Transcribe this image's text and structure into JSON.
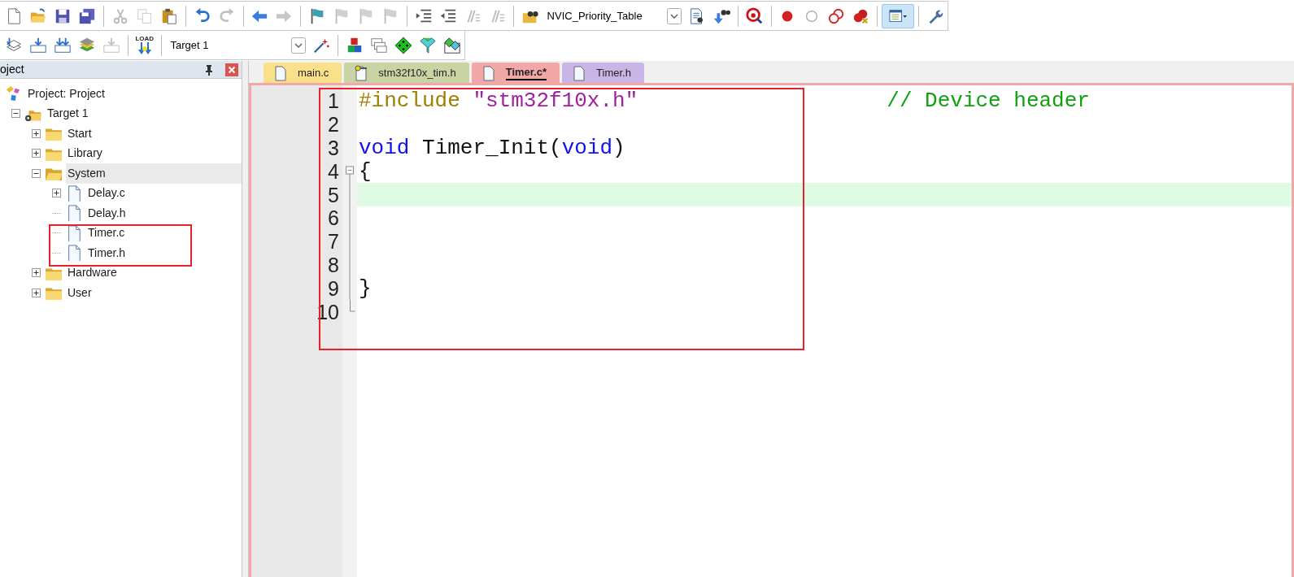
{
  "toolbar_1": [
    {
      "kind": "new",
      "disabled": false,
      "pressed": false
    },
    {
      "kind": "open",
      "disabled": false,
      "pressed": false
    },
    {
      "kind": "save",
      "disabled": false,
      "pressed": false
    },
    {
      "kind": "save_all",
      "disabled": false,
      "pressed": false
    },
    {
      "kind": "separator"
    },
    {
      "kind": "cut",
      "disabled": true,
      "pressed": false
    },
    {
      "kind": "copy",
      "disabled": true,
      "pressed": false
    },
    {
      "kind": "paste",
      "disabled": false,
      "pressed": false
    },
    {
      "kind": "separator"
    },
    {
      "kind": "undo",
      "disabled": false,
      "pressed": false
    },
    {
      "kind": "redo",
      "disabled": true,
      "pressed": false
    },
    {
      "kind": "separator"
    },
    {
      "kind": "back",
      "disabled": false,
      "pressed": false
    },
    {
      "kind": "forward",
      "disabled": true,
      "pressed": false
    },
    {
      "kind": "separator"
    },
    {
      "kind": "bookmark",
      "disabled": false,
      "pressed": false
    },
    {
      "kind": "bookmark",
      "disabled": true,
      "pressed": false
    },
    {
      "kind": "bookmark",
      "disabled": true,
      "pressed": false
    },
    {
      "kind": "bookmark",
      "disabled": true,
      "pressed": false
    },
    {
      "kind": "separator"
    },
    {
      "kind": "indent",
      "disabled": false,
      "pressed": false
    },
    {
      "kind": "unindent",
      "disabled": false,
      "pressed": false
    },
    {
      "kind": "comment",
      "disabled": true,
      "pressed": false
    },
    {
      "kind": "comment",
      "disabled": true,
      "pressed": false
    },
    {
      "kind": "separator"
    },
    {
      "kind": "find_files",
      "disabled": false,
      "pressed": false
    },
    {
      "kind": "combo",
      "value": "NVIC_Priority_Table"
    },
    {
      "kind": "find",
      "disabled": false,
      "pressed": false
    },
    {
      "kind": "incremental_find",
      "disabled": false,
      "pressed": false
    },
    {
      "kind": "separator"
    },
    {
      "kind": "debug",
      "disabled": false,
      "pressed": false
    },
    {
      "kind": "separator"
    },
    {
      "kind": "breakpoint",
      "disabled": false,
      "pressed": false
    },
    {
      "kind": "breakpoint_off",
      "disabled": false,
      "pressed": false
    },
    {
      "kind": "breakpoint_enable",
      "disabled": false,
      "pressed": false
    },
    {
      "kind": "breakpoint_kill",
      "disabled": false,
      "pressed": false
    },
    {
      "kind": "separator"
    },
    {
      "kind": "window",
      "disabled": false,
      "pressed": true
    },
    {
      "kind": "separator"
    },
    {
      "kind": "wrench",
      "disabled": false,
      "pressed": false
    }
  ],
  "toolbar_2": [
    {
      "kind": "translate",
      "disabled": false,
      "pressed": false
    },
    {
      "kind": "build",
      "disabled": false,
      "pressed": false
    },
    {
      "kind": "rebuild",
      "disabled": false,
      "pressed": false
    },
    {
      "kind": "batch",
      "disabled": false,
      "pressed": false
    },
    {
      "kind": "build",
      "disabled": true,
      "pressed": false
    },
    {
      "kind": "separator"
    },
    {
      "kind": "load",
      "label": "LOAD",
      "disabled": false,
      "pressed": false
    },
    {
      "kind": "separator"
    },
    {
      "kind": "combo",
      "value": "Target 1"
    },
    {
      "kind": "wand",
      "disabled": false,
      "pressed": false
    },
    {
      "kind": "separator"
    },
    {
      "kind": "blocks",
      "disabled": false,
      "pressed": false
    },
    {
      "kind": "windows",
      "disabled": false,
      "pressed": false
    },
    {
      "kind": "diamond",
      "disabled": false,
      "pressed": false
    },
    {
      "kind": "funnel",
      "disabled": false,
      "pressed": false
    },
    {
      "kind": "packs",
      "disabled": false,
      "pressed": false
    }
  ],
  "project_panel": {
    "title": "oject",
    "tree": [
      {
        "kind": "project",
        "label": "Project: Project",
        "selected": false,
        "children": [
          {
            "kind": "target",
            "label": "Target 1",
            "expanded": true,
            "selected": false,
            "children": [
              {
                "kind": "group",
                "label": "Start",
                "expanded": false,
                "selected": false
              },
              {
                "kind": "group",
                "label": "Library",
                "expanded": false,
                "selected": false
              },
              {
                "kind": "group",
                "label": "System",
                "expanded": true,
                "selected": true,
                "children": [
                  {
                    "kind": "file",
                    "label": "Delay.c",
                    "expanded": false,
                    "selected": false
                  },
                  {
                    "kind": "file",
                    "label": "Delay.h",
                    "selected": false
                  },
                  {
                    "kind": "file",
                    "label": "Timer.c",
                    "selected": false
                  },
                  {
                    "kind": "file",
                    "label": "Timer.h",
                    "selected": false
                  }
                ]
              },
              {
                "kind": "group",
                "label": "Hardware",
                "expanded": false,
                "selected": false
              },
              {
                "kind": "group",
                "label": "User",
                "expanded": false,
                "selected": false
              }
            ]
          }
        ]
      }
    ]
  },
  "tabs": [
    {
      "label": "main.c",
      "color": "#fbe08c",
      "selected": false,
      "kind": "file"
    },
    {
      "label": "stm32f10x_tim.h",
      "color": "#c9d3a4",
      "selected": false,
      "kind": "readonly"
    },
    {
      "label": "Timer.c*",
      "color": "#f2a8a6",
      "selected": true,
      "kind": "file"
    },
    {
      "label": "Timer.h",
      "color": "#c9b6e6",
      "selected": false,
      "kind": "file"
    }
  ],
  "code_lines": [
    {
      "number": "1",
      "tokens": [
        {
          "kind": "preprocessor",
          "text": "#include "
        },
        {
          "kind": "string",
          "text": "\"stm32f10x.h\""
        },
        {
          "kind": "comment",
          "text": "// Device header"
        }
      ]
    },
    {
      "number": "2"
    },
    {
      "number": "3",
      "tokens": [
        {
          "kind": "keyword",
          "text": "void"
        },
        {
          "kind": "plain",
          "text": " Timer_Init("
        },
        {
          "kind": "keyword",
          "text": "void"
        },
        {
          "kind": "plain",
          "text": ")"
        }
      ]
    },
    {
      "number": "4",
      "fold_expanded": true,
      "tokens": [
        {
          "kind": "plain",
          "text": "{"
        }
      ]
    },
    {
      "number": "5",
      "current": true
    },
    {
      "number": "6"
    },
    {
      "number": "7"
    },
    {
      "number": "8"
    },
    {
      "number": "9",
      "tokens": [
        {
          "kind": "plain",
          "text": "}"
        }
      ]
    },
    {
      "number": "10"
    }
  ]
}
